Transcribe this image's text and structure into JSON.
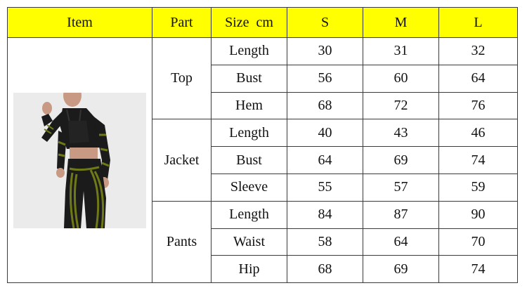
{
  "table": {
    "headers": [
      "Item",
      "Part",
      "Size  cm",
      "S",
      "M",
      "L"
    ],
    "sections": [
      {
        "part": "Top",
        "rows": [
          {
            "measure": "Length",
            "S": "30",
            "M": "31",
            "L": "32"
          },
          {
            "measure": "Bust",
            "S": "56",
            "M": "60",
            "L": "64"
          },
          {
            "measure": "Hem",
            "S": "68",
            "M": "72",
            "L": "76"
          }
        ]
      },
      {
        "part": "Jacket",
        "rows": [
          {
            "measure": "Length",
            "S": "40",
            "M": "43",
            "L": "46"
          },
          {
            "measure": "Bust",
            "S": "64",
            "M": "69",
            "L": "74"
          },
          {
            "measure": "Sleeve",
            "S": "55",
            "M": "57",
            "L": "59"
          }
        ]
      },
      {
        "part": "Pants",
        "rows": [
          {
            "measure": "Length",
            "S": "84",
            "M": "87",
            "L": "90"
          },
          {
            "measure": "Waist",
            "S": "58",
            "M": "64",
            "L": "70"
          },
          {
            "measure": "Hip",
            "S": "68",
            "M": "69",
            "L": "74"
          }
        ]
      }
    ]
  },
  "colors": {
    "header_background": "#ffff00",
    "garment_black": "#1b1b1b",
    "garment_accent": "#6f7a16"
  }
}
